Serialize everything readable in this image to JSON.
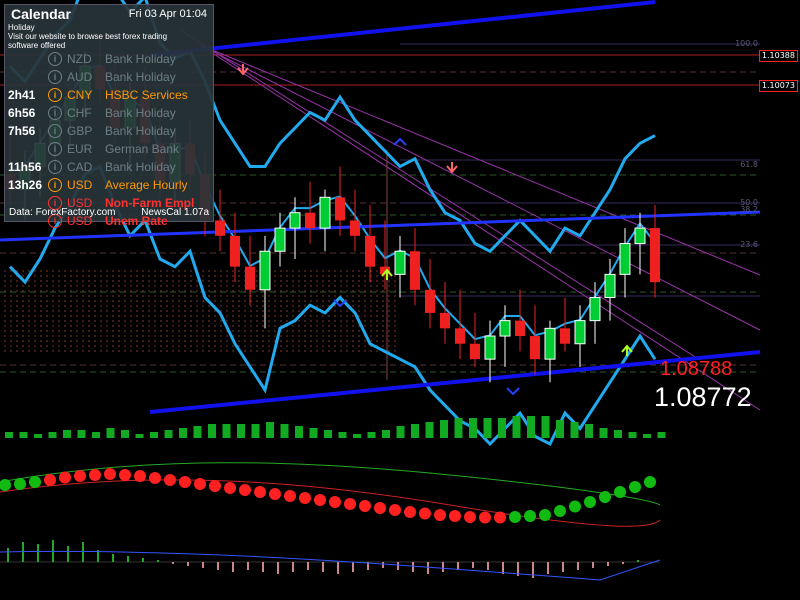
{
  "prices": {
    "bid": "1.08772",
    "ask": "1.08788"
  },
  "hlines": [
    "1.10388",
    "1.10073"
  ],
  "fib_levels": [
    "100.0",
    "61.8",
    "50.0",
    "38.2",
    "23.6"
  ],
  "calendar": {
    "title": "Calendar",
    "date": "Fri 03 Apr 01:04",
    "ad_lines": [
      "Holiday",
      "Visit our website to browse best forex trading",
      "software offered"
    ],
    "events": [
      {
        "time": "",
        "currency": "NZD",
        "title": "Bank Holiday",
        "color": "#6d7f86",
        "impact": "low"
      },
      {
        "time": "",
        "currency": "AUD",
        "title": "Bank Holiday",
        "color": "#6d7f86",
        "impact": "low"
      },
      {
        "time": "2h41",
        "currency": "CNY",
        "title": "HSBC Services",
        "color": "#ff9900",
        "impact": "medium"
      },
      {
        "time": "6h56",
        "currency": "CHF",
        "title": "Bank Holiday",
        "color": "#6d7f86",
        "impact": "low"
      },
      {
        "time": "7h56",
        "currency": "GBP",
        "title": "Bank Holiday",
        "color": "#6d7f86",
        "impact": "low"
      },
      {
        "time": "",
        "currency": "EUR",
        "title": "German Bank",
        "color": "#6d7f86",
        "impact": "low"
      },
      {
        "time": "11h56",
        "currency": "CAD",
        "title": "Bank Holiday",
        "color": "#6d7f86",
        "impact": "low"
      },
      {
        "time": "13h26",
        "currency": "USD",
        "title": "Average Hourly",
        "color": "#ff9900",
        "impact": "medium"
      },
      {
        "time": "",
        "currency": "USD",
        "title": "Non-Farm Empl",
        "color": "#ff3030",
        "impact": "high"
      },
      {
        "time": "",
        "currency": "USD",
        "title": "Unem Rate",
        "color": "#ff3030",
        "impact": "high"
      }
    ],
    "footer_left": "Data: ForexFactory.com",
    "footer_right": "NewsCal 1.07a"
  },
  "colors": {
    "bull": "#00cc33",
    "bear": "#ee2020",
    "band": "#22aaee",
    "trend": "#1111ee",
    "fib": "#9933aa",
    "level": "#aa2222"
  },
  "candles": [
    {
      "o": 1.1,
      "h": 1.1025,
      "l": 1.098,
      "c": 1.099
    },
    {
      "o": 1.099,
      "h": 1.1015,
      "l": 1.097,
      "c": 1.1005
    },
    {
      "o": 1.1005,
      "h": 1.103,
      "l": 1.0985,
      "c": 1.102
    },
    {
      "o": 1.102,
      "h": 1.1045,
      "l": 1.1005,
      "c": 1.1035
    },
    {
      "o": 1.1035,
      "h": 1.1055,
      "l": 1.102,
      "c": 1.105
    },
    {
      "o": 1.105,
      "h": 1.108,
      "l": 1.104,
      "c": 1.107
    },
    {
      "o": 1.107,
      "h": 1.109,
      "l": 1.1045,
      "c": 1.1055
    },
    {
      "o": 1.1055,
      "h": 1.1075,
      "l": 1.102,
      "c": 1.103
    },
    {
      "o": 1.103,
      "h": 1.106,
      "l": 1.1,
      "c": 1.105
    },
    {
      "o": 1.105,
      "h": 1.107,
      "l": 1.101,
      "c": 1.102
    },
    {
      "o": 1.102,
      "h": 1.104,
      "l": 1.0985,
      "c": 1.0995
    },
    {
      "o": 1.0995,
      "h": 1.103,
      "l": 1.098,
      "c": 1.102
    },
    {
      "o": 1.102,
      "h": 1.1035,
      "l": 1.099,
      "c": 1.1
    },
    {
      "o": 1.1,
      "h": 1.1015,
      "l": 1.096,
      "c": 1.097
    },
    {
      "o": 1.097,
      "h": 1.099,
      "l": 1.095,
      "c": 1.096
    },
    {
      "o": 1.096,
      "h": 1.0975,
      "l": 1.093,
      "c": 1.094
    },
    {
      "o": 1.094,
      "h": 1.096,
      "l": 1.0915,
      "c": 1.0925
    },
    {
      "o": 1.0925,
      "h": 1.096,
      "l": 1.09,
      "c": 1.095
    },
    {
      "o": 1.095,
      "h": 1.0975,
      "l": 1.094,
      "c": 1.0965
    },
    {
      "o": 1.0965,
      "h": 1.0985,
      "l": 1.0945,
      "c": 1.0975
    },
    {
      "o": 1.0975,
      "h": 1.0995,
      "l": 1.0955,
      "c": 1.0965
    },
    {
      "o": 1.0965,
      "h": 1.099,
      "l": 1.095,
      "c": 1.0985
    },
    {
      "o": 1.0985,
      "h": 1.1005,
      "l": 1.096,
      "c": 1.097
    },
    {
      "o": 1.097,
      "h": 1.099,
      "l": 1.095,
      "c": 1.096
    },
    {
      "o": 1.096,
      "h": 1.098,
      "l": 1.093,
      "c": 1.094
    },
    {
      "o": 1.094,
      "h": 1.097,
      "l": 1.0925,
      "c": 1.0935
    },
    {
      "o": 1.0935,
      "h": 1.096,
      "l": 1.092,
      "c": 1.095
    },
    {
      "o": 1.095,
      "h": 1.0965,
      "l": 1.0915,
      "c": 1.0925
    },
    {
      "o": 1.0925,
      "h": 1.0945,
      "l": 1.09,
      "c": 1.091
    },
    {
      "o": 1.091,
      "h": 1.093,
      "l": 1.089,
      "c": 1.09
    },
    {
      "o": 1.09,
      "h": 1.0925,
      "l": 1.088,
      "c": 1.089
    },
    {
      "o": 1.089,
      "h": 1.091,
      "l": 1.0875,
      "c": 1.088
    },
    {
      "o": 1.088,
      "h": 1.0905,
      "l": 1.0865,
      "c": 1.0895
    },
    {
      "o": 1.0895,
      "h": 1.0915,
      "l": 1.0875,
      "c": 1.0905
    },
    {
      "o": 1.0905,
      "h": 1.0925,
      "l": 1.0885,
      "c": 1.0895
    },
    {
      "o": 1.0895,
      "h": 1.0915,
      "l": 1.087,
      "c": 1.088
    },
    {
      "o": 1.088,
      "h": 1.0905,
      "l": 1.0865,
      "c": 1.09
    },
    {
      "o": 1.09,
      "h": 1.092,
      "l": 1.0885,
      "c": 1.089
    },
    {
      "o": 1.089,
      "h": 1.0915,
      "l": 1.0875,
      "c": 1.0905
    },
    {
      "o": 1.0905,
      "h": 1.093,
      "l": 1.089,
      "c": 1.092
    },
    {
      "o": 1.092,
      "h": 1.0945,
      "l": 1.0905,
      "c": 1.0935
    },
    {
      "o": 1.0935,
      "h": 1.0965,
      "l": 1.092,
      "c": 1.0955
    },
    {
      "o": 1.0955,
      "h": 1.0975,
      "l": 1.0935,
      "c": 1.0965
    },
    {
      "o": 1.0965,
      "h": 1.098,
      "l": 1.092,
      "c": 1.093
    }
  ],
  "hist1": [
    6,
    6,
    4,
    6,
    8,
    8,
    6,
    10,
    8,
    4,
    6,
    8,
    10,
    12,
    14,
    14,
    14,
    14,
    16,
    14,
    12,
    10,
    8,
    6,
    4,
    6,
    8,
    12,
    14,
    16,
    18,
    20,
    20,
    20,
    20,
    22,
    22,
    22,
    18,
    16,
    14,
    10,
    8,
    6,
    4,
    6
  ],
  "osc_dots": [
    0.7,
    0.72,
    0.76,
    0.8,
    0.85,
    0.88,
    0.9,
    0.92,
    0.9,
    0.88,
    0.84,
    0.8,
    0.76,
    0.72,
    0.68,
    0.64,
    0.6,
    0.56,
    0.52,
    0.48,
    0.44,
    0.4,
    0.36,
    0.32,
    0.28,
    0.24,
    0.2,
    0.16,
    0.13,
    0.1,
    0.08,
    0.06,
    0.05,
    0.05,
    0.06,
    0.08,
    0.1,
    0.12,
    0.15,
    0.18,
    0.22,
    0.26,
    0.3,
    0.34
  ],
  "hist3": [
    14,
    20,
    18,
    22,
    16,
    20,
    12,
    8,
    6,
    4,
    2,
    -2,
    -4,
    -6,
    -8,
    -10,
    -8,
    -10,
    -12,
    -10,
    -8,
    -10,
    -12,
    -10,
    -8,
    -6,
    -8,
    -10,
    -12,
    -10,
    -8,
    -6,
    -8,
    -12,
    -14,
    -16,
    -12,
    -10,
    -8,
    -6,
    -4,
    -2,
    2
  ]
}
